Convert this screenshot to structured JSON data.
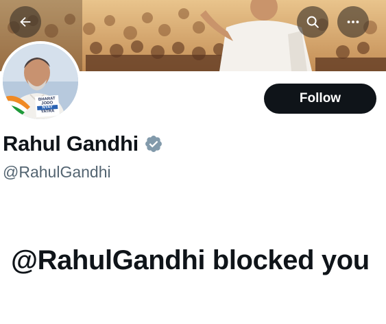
{
  "header": {
    "back_icon": "arrow-left-icon",
    "search_icon": "search-icon",
    "more_icon": "more-horizontal-icon"
  },
  "avatar": {
    "badge_lines": [
      "BHARAT",
      "JODO",
      "NYAY",
      "YATRA"
    ]
  },
  "profile": {
    "follow_label": "Follow",
    "display_name": "Rahul Gandhi",
    "verified_icon": "verified-badge-icon",
    "handle": "@RahulGandhi"
  },
  "message": {
    "blocked_text": "@RahulGandhi blocked you"
  },
  "colors": {
    "text_primary": "#0f1419",
    "text_secondary": "#536471",
    "follow_bg": "#0f1419",
    "verified_gray": "#829aab"
  }
}
